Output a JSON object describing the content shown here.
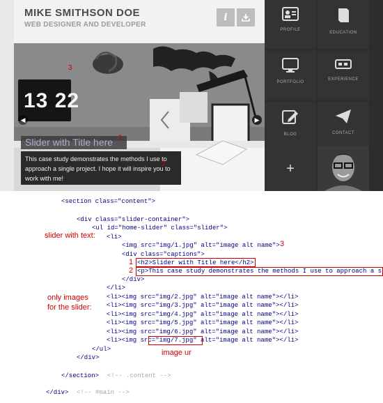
{
  "header": {
    "name": "MIKE SMITHSON DOE",
    "subtitle": "WEB DESIGNER AND DEVELOPER",
    "info_icon": "i"
  },
  "slider": {
    "clock": "13 22",
    "title": "Slider with Title here",
    "text": "This case study demonstrates the methods I use to approach a single project. I hope it will inspire you to work with me!",
    "prev_icon": "◀",
    "next_icon": "▶",
    "markers": {
      "title": "1",
      "text": "2",
      "image": "3"
    }
  },
  "tiles": [
    {
      "label": "PROFILE",
      "icon": "profile-icon"
    },
    {
      "label": "EDUCATION",
      "icon": "education-icon"
    },
    {
      "label": "PORTFOLIO",
      "icon": "portfolio-icon"
    },
    {
      "label": "EXPERIENCE",
      "icon": "experience-icon"
    },
    {
      "label": "BLOG",
      "icon": "blog-icon"
    },
    {
      "label": "CONTACT",
      "icon": "contact-icon"
    }
  ],
  "plus": "+",
  "code_lines": [
    "<section class=\"content\">",
    "<div class=\"slider-container\">",
    "<ul id=\"home-slider\" class=\"slider\">",
    "<li>",
    "<img src=\"img/1.jpg\" alt=\"image alt name\">",
    "<div class=\"captions\">",
    "<h2>Slider with Title here</h2>",
    "<p>This case study demonstrates the methods I use to approach a s",
    "</div>",
    "</li>",
    "<li><img src=\"img/2.jpg\" alt=\"image alt name\"></li>",
    "<li><img src=\"img/3.jpg\" alt=\"image alt name\"></li>",
    "<li><img src=\"img/4.jpg\" alt=\"image alt name\"></li>",
    "<li><img src=\"img/5.jpg\" alt=\"image alt name\"></li>",
    "<li><img src=\"img/6.jpg\" alt=\"image alt name\"></li>",
    "<li><img src=\"img/7.jpg\" alt=\"image alt name\"></li>",
    "</ul>",
    "</div>",
    "</section>",
    "<!-- .content -->",
    "</div>",
    "<!-- #main -->"
  ],
  "annotations": {
    "slider_with_text": "slider with text:",
    "only_images": "only images\nfor the slider:",
    "image_url": "image ur",
    "num3": "3",
    "num1": "1",
    "num2": "2"
  },
  "colors": {
    "annotation": "#d10000",
    "code": "#000080",
    "comment": "#aaaaaa",
    "tile_bg": "#333333"
  }
}
